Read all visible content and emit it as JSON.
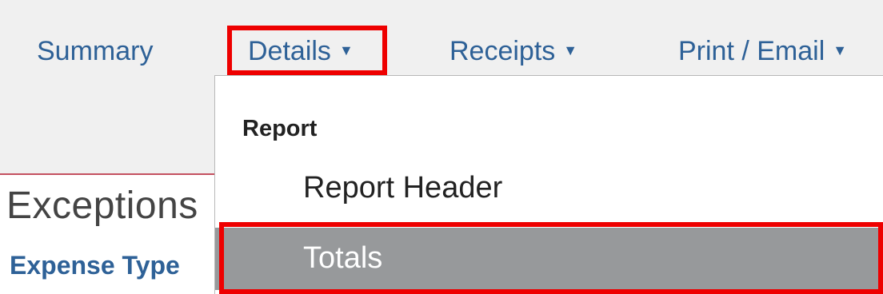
{
  "nav": {
    "summary_label": "Summary",
    "details_label": "Details",
    "receipts_label": "Receipts",
    "print_email_label": "Print / Email",
    "caret_glyph": "▼"
  },
  "content": {
    "section_title": "Exceptions",
    "column_header": "Expense Type"
  },
  "details_menu": {
    "section_heading": "Report",
    "items": [
      {
        "label": "Report Header",
        "selected": false
      },
      {
        "label": "Totals",
        "selected": true
      }
    ]
  },
  "colors": {
    "link_blue": "#2e6197",
    "highlight_red": "#ee0000",
    "selected_item_bg": "#97999b",
    "divider_red": "#c4505f"
  }
}
